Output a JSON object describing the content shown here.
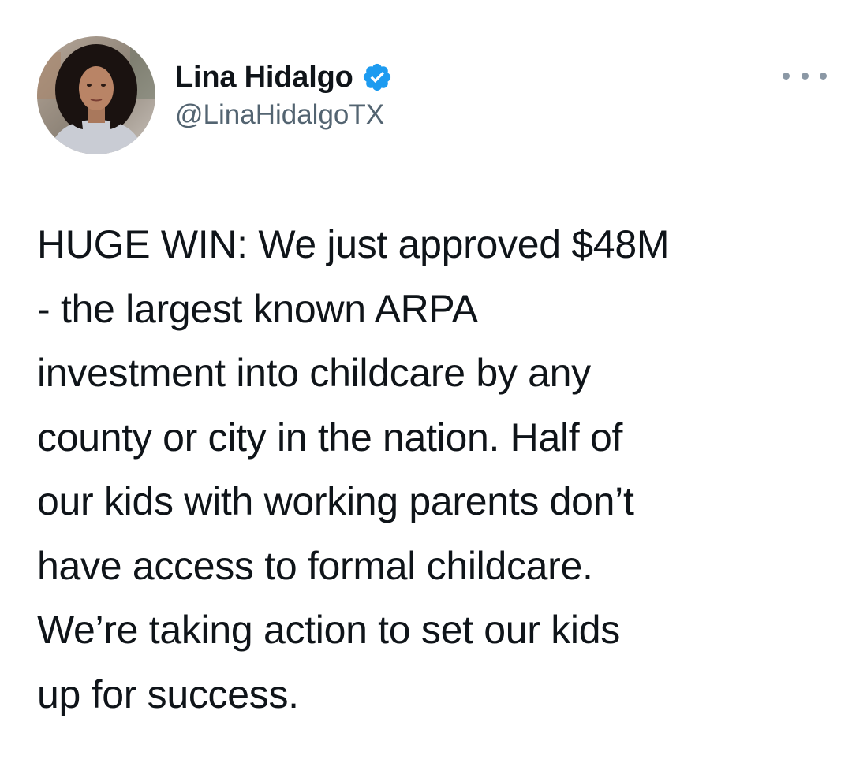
{
  "author": {
    "display_name": "Lina Hidalgo",
    "handle": "@LinaHidalgoTX",
    "verified": true
  },
  "icons": {
    "verified": "verified-badge-icon",
    "more": "more-options-icon"
  },
  "colors": {
    "verified_blue": "#1d9bf0",
    "text_primary": "#0f1419",
    "text_secondary": "#536471"
  },
  "tweet": {
    "lines": [
      "HUGE WIN: We just approved $48M",
      "- the largest known ARPA",
      "investment into childcare by any",
      "county or city in the nation. Half of",
      "our kids with working parents don’t",
      "have access to formal childcare.",
      "We’re taking action to set our kids",
      "up for success."
    ]
  }
}
